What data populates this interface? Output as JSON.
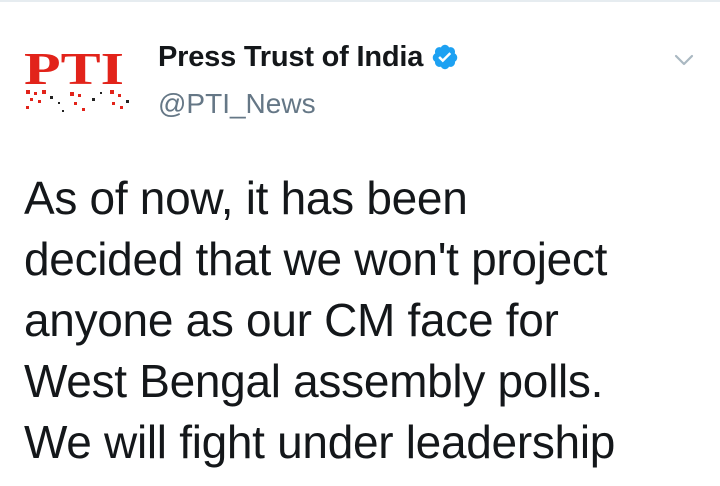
{
  "tweet": {
    "author": {
      "display_name": "Press Trust of India",
      "handle": "@PTI_News",
      "verified": true,
      "avatar_logo": "PTI"
    },
    "text": "As of now, it has been\ndecided that we won't project\nanyone as our CM face for\nWest Bengal assembly polls.\nWe will fight under leadership",
    "menu_icon": "chevron-down-icon"
  },
  "colors": {
    "verified_badge": "#1da1f2",
    "logo_red": "#e2231a",
    "handle_gray": "#657786",
    "text_dark": "#14171a"
  }
}
